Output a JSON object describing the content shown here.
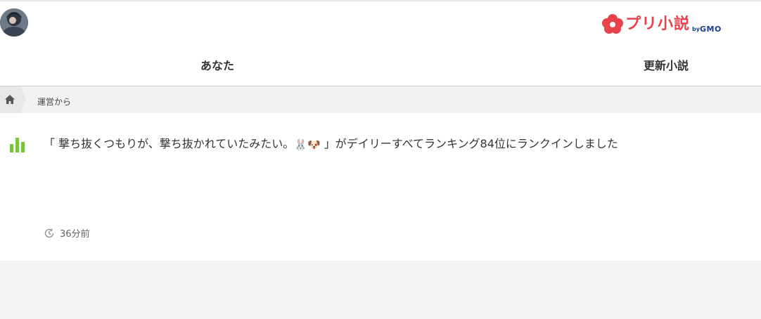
{
  "header": {
    "logo": {
      "name": "プリ小説",
      "by": "by",
      "brand": "GMO"
    },
    "tabs": [
      {
        "label": "あなた"
      },
      {
        "label": "更新小説"
      }
    ]
  },
  "breadcrumb": {
    "current": "運営から"
  },
  "notification": {
    "text_before": "「 撃ち抜くつもりが、撃ち抜かれていたみたい。",
    "emoji_1": "🐰",
    "emoji_2": "🐶",
    "text_after": " 」がデイリーすべてランキング84位にランクインしました",
    "time": "36分前"
  },
  "colors": {
    "accent": "#e8434c",
    "ranking_icon": "#7cc243",
    "gmo_blue": "#1a3e8a"
  }
}
